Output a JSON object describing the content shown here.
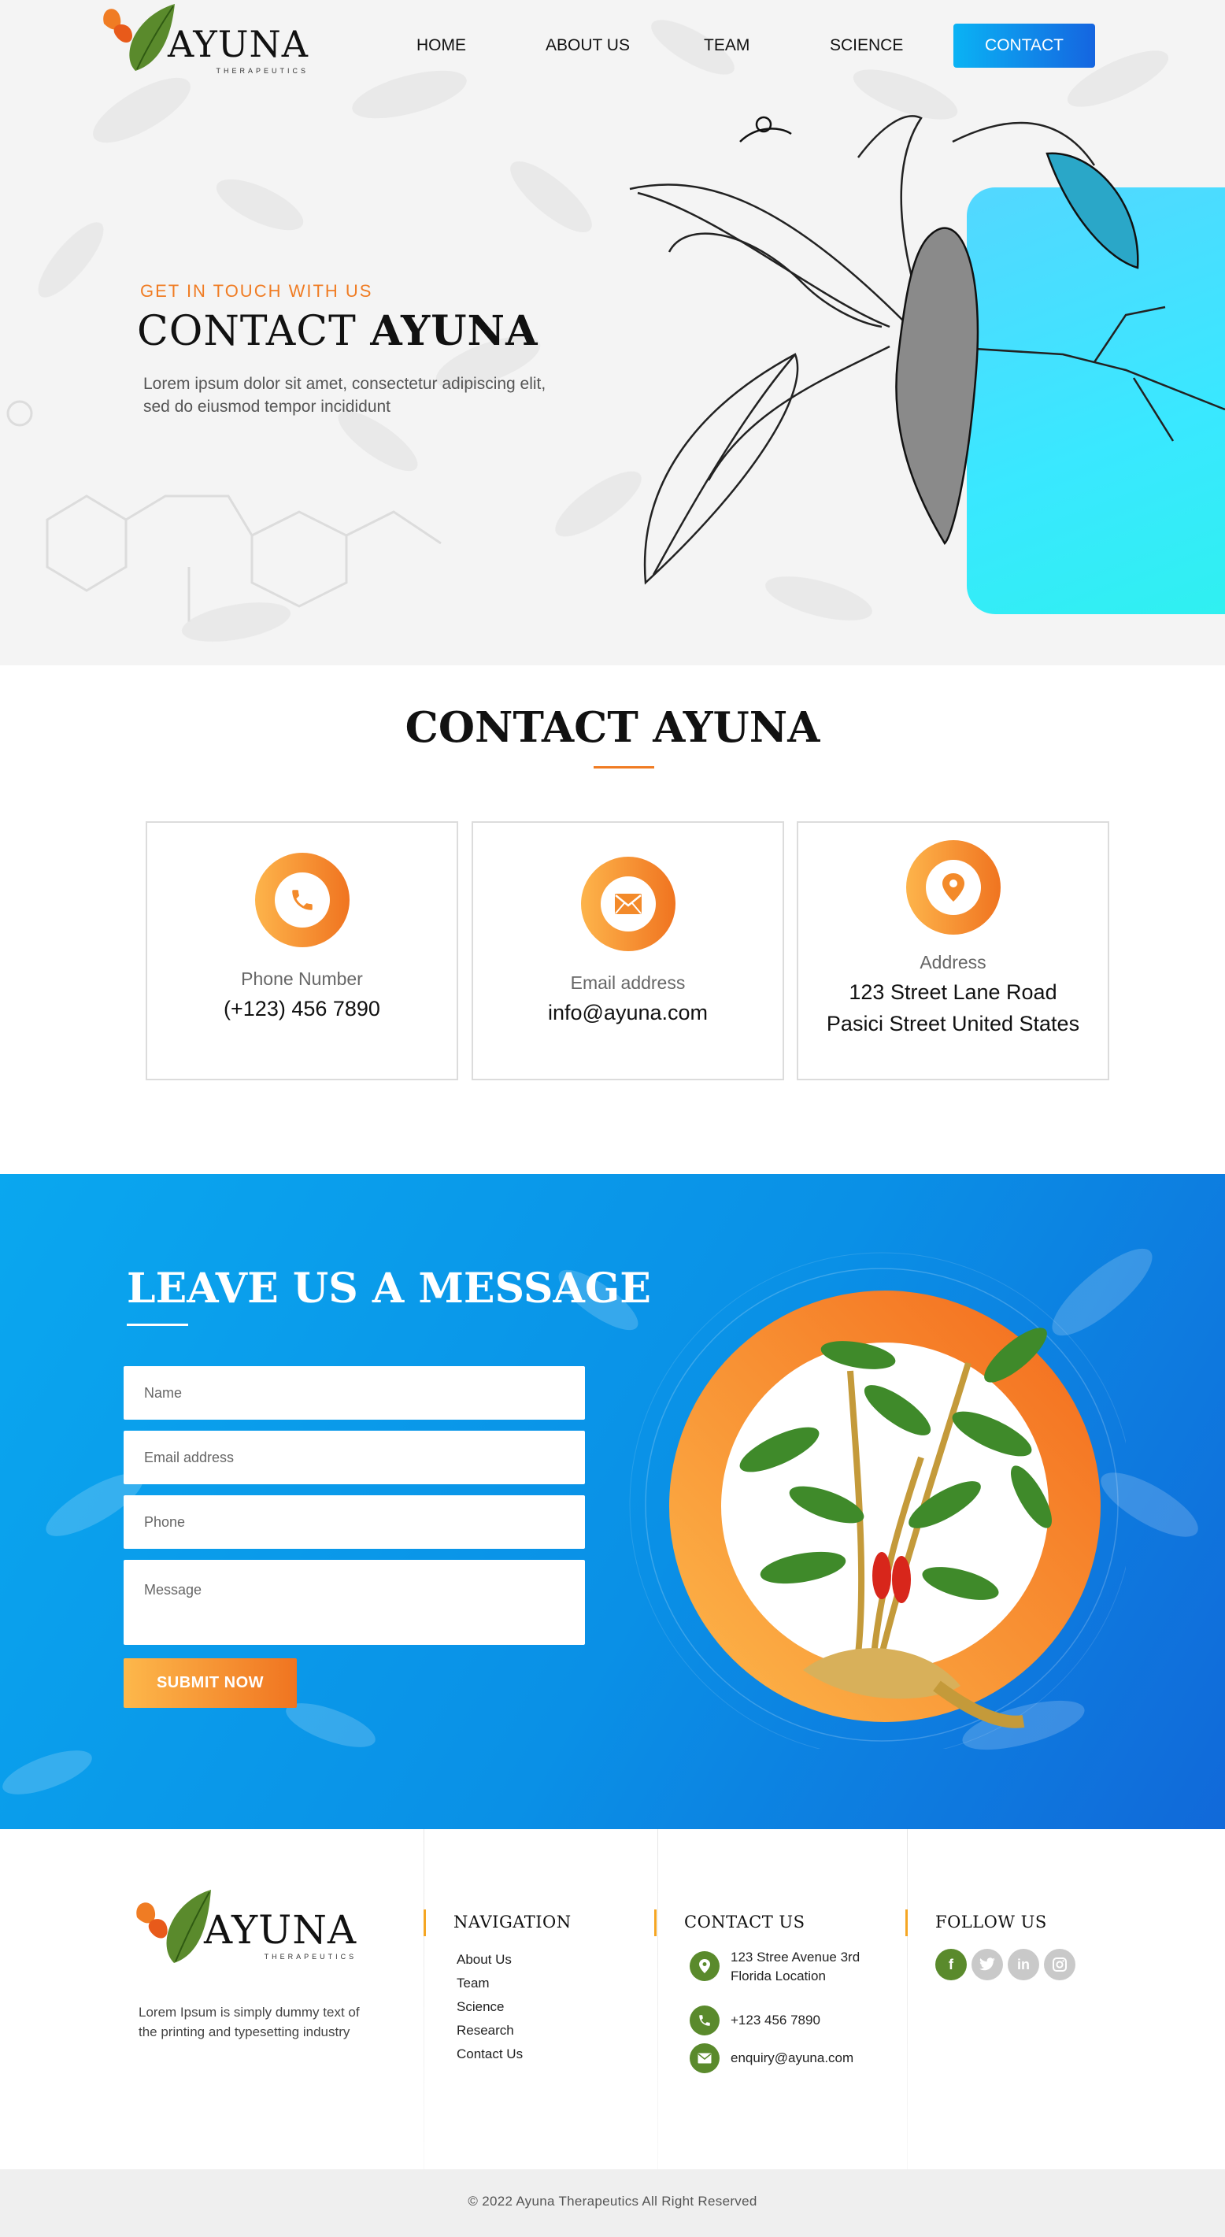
{
  "brand": {
    "name": "AYUNA",
    "tagline": "THERAPEUTICS"
  },
  "nav": {
    "items": [
      "HOME",
      "ABOUT US",
      "TEAM",
      "SCIENCE"
    ],
    "cta": "CONTACT"
  },
  "hero": {
    "kicker": "GET IN TOUCH WITH US",
    "title_light": "CONTACT",
    "title_bold": "AYUNA",
    "description": "Lorem ipsum dolor sit amet, consectetur adipiscing elit, sed do eiusmod tempor incididunt"
  },
  "contact_section": {
    "title_light": "CONTACT",
    "title_bold": "AYUNA",
    "cards": [
      {
        "icon": "phone-icon",
        "label": "Phone Number",
        "value": "(+123) 456 7890"
      },
      {
        "icon": "mail-icon",
        "label": "Email address",
        "value": "info@ayuna.com"
      },
      {
        "icon": "location-pin-icon",
        "label": "Address",
        "value_line1": "123 Street Lane Road",
        "value_line2": "Pasici Street United States"
      }
    ]
  },
  "message_section": {
    "title_light": "LEAVE US A",
    "title_bold": "MESSAGE",
    "fields": {
      "name": "Name",
      "email": "Email address",
      "phone": "Phone",
      "message": "Message"
    },
    "submit": "SUBMIT NOW"
  },
  "footer": {
    "about_text": "Lorem Ipsum is simply dummy text of the printing and typesetting industry",
    "navigation": {
      "title": "NAVIGATION",
      "items": [
        "About Us",
        "Team",
        "Science",
        "Research",
        "Contact Us"
      ]
    },
    "contact": {
      "title": "CONTACT US",
      "address_line1": "123 Stree Avenue 3rd",
      "address_line2": "Florida Location",
      "phone": "+123 456 7890",
      "email": "enquiry@ayuna.com"
    },
    "follow": {
      "title": "FOLLOW US",
      "icons": [
        "facebook-icon",
        "twitter-icon",
        "linkedin-icon",
        "instagram-icon"
      ]
    },
    "copyright": "© 2022 Ayuna Therapeutics  All Right Reserved"
  },
  "colors": {
    "accent_orange": "#f07c23",
    "accent_blue": "#0a90e6",
    "cyan": "#39e8ff",
    "leaf_green": "#5a8a2c"
  }
}
